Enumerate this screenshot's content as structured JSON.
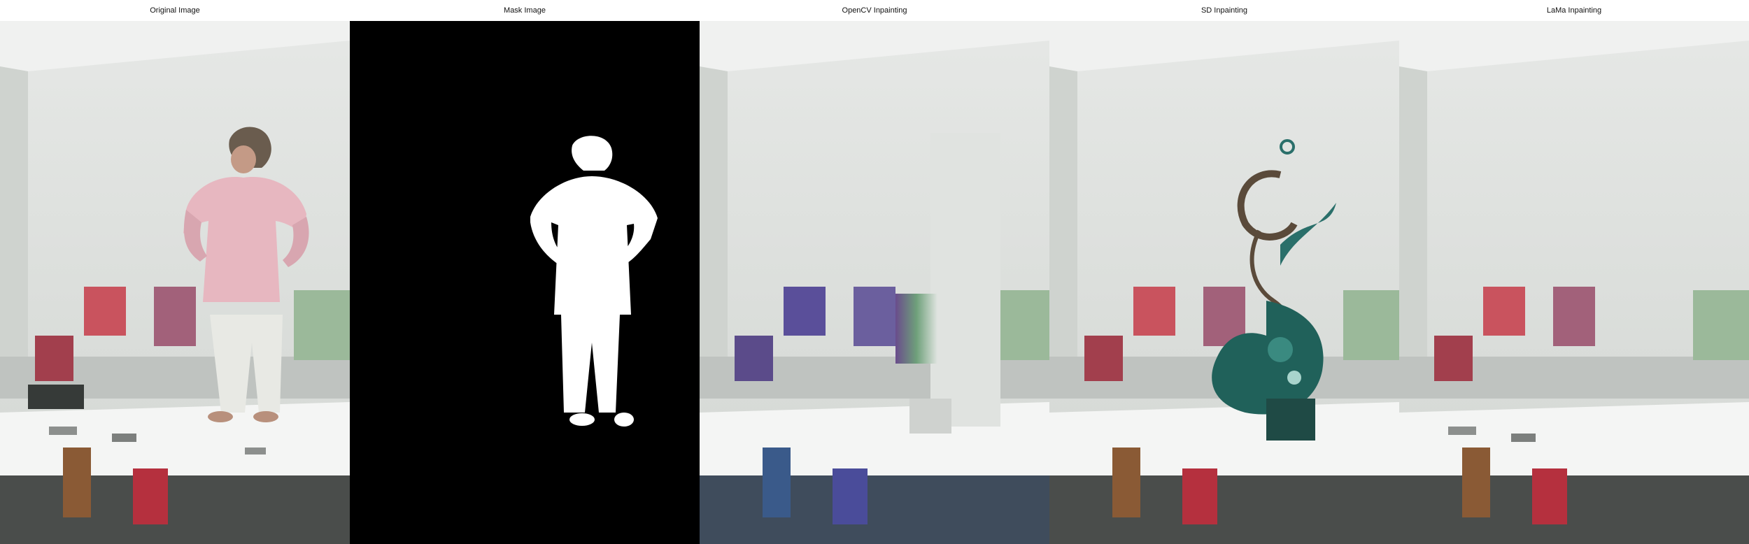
{
  "panels": [
    {
      "title": "Original Image"
    },
    {
      "title": "Mask Image"
    },
    {
      "title": "OpenCV Inpainting"
    },
    {
      "title": "SD Inpainting"
    },
    {
      "title": "LaMa Inpainting"
    }
  ],
  "colors": {
    "wall": "#dcdfdc",
    "ceiling": "#eef0ee",
    "table": "#f2f3f2",
    "mask_bg": "#000000",
    "mask_fg": "#ffffff",
    "shirt": "#e7b7c0",
    "sd_pattern": "#20615a"
  }
}
